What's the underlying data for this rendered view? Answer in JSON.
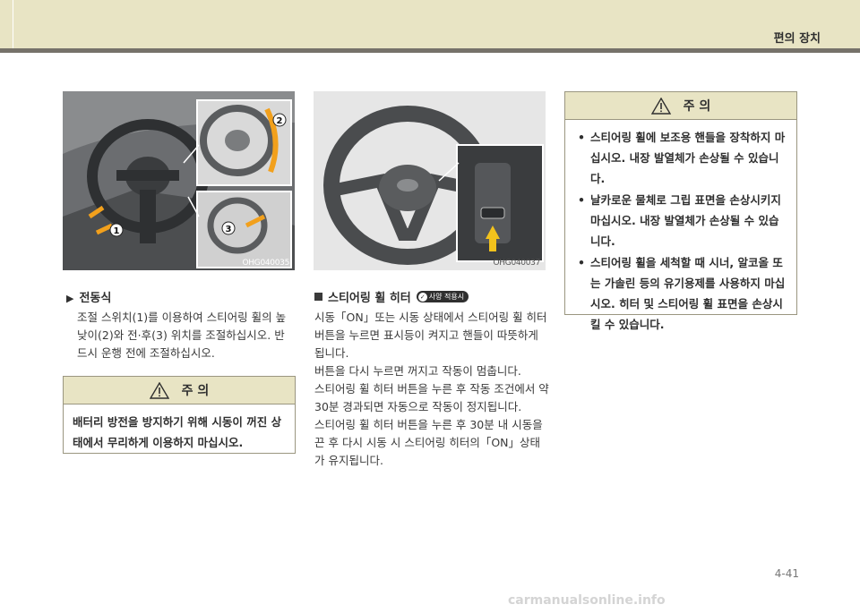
{
  "header": {
    "section_title": "편의 장치"
  },
  "figures": [
    {
      "code": "OHG040035",
      "callouts": [
        "1",
        "2",
        "3"
      ]
    },
    {
      "code": "OHG040037"
    }
  ],
  "power": {
    "heading": "전동식",
    "paragraph": "조절 스위치(1)를 이용하여 스티어링 휠의 높낮이(2)와 전·후(3) 위치를 조절하십시오. 반드시 운행 전에 조절하십시오."
  },
  "caution1": {
    "title": "주  의",
    "text": "배터리 방전을 방지하기 위해 시동이 꺼진 상태에서 무리하게 이용하지 마십시오."
  },
  "heater": {
    "heading": "스티어링 휠 히터",
    "badge": "사양 적용시",
    "paragraphs": [
      "시동「ON」또는 시동 상태에서 스티어링 휠 히터 버튼을 누르면 표시등이 켜지고 핸들이 따뜻하게 됩니다.",
      "버튼을 다시 누르면 꺼지고 작동이 멈춥니다.",
      "스티어링 휠 히터 버튼을 누른 후 작동 조건에서 약 30분 경과되면 자동으로 작동이 정지됩니다.",
      "스티어링 휠 히터 버튼을 누른 후 30분 내 시동을 끈 후 다시 시동 시 스티어링 히터의「ON」상태가 유지됩니다."
    ]
  },
  "caution2": {
    "title": "주  의",
    "items": [
      "스티어링 휠에 보조용 핸들을 장착하지 마십시오. 내장 발열체가 손상될 수 있습니다.",
      "날카로운 물체로 그립 표면을 손상시키지 마십시오. 내장 발열체가 손상될 수 있습니다.",
      "스티어링 휠을 세척할 때 시너, 알코올 또는 가솔린 등의 유기용제를 사용하지 마십시오. 히터 및 스티어링 휠 표면을 손상시킬 수 있습니다."
    ]
  },
  "footer": {
    "page_number": "4-41",
    "watermark": "carmanualsonline.info"
  }
}
